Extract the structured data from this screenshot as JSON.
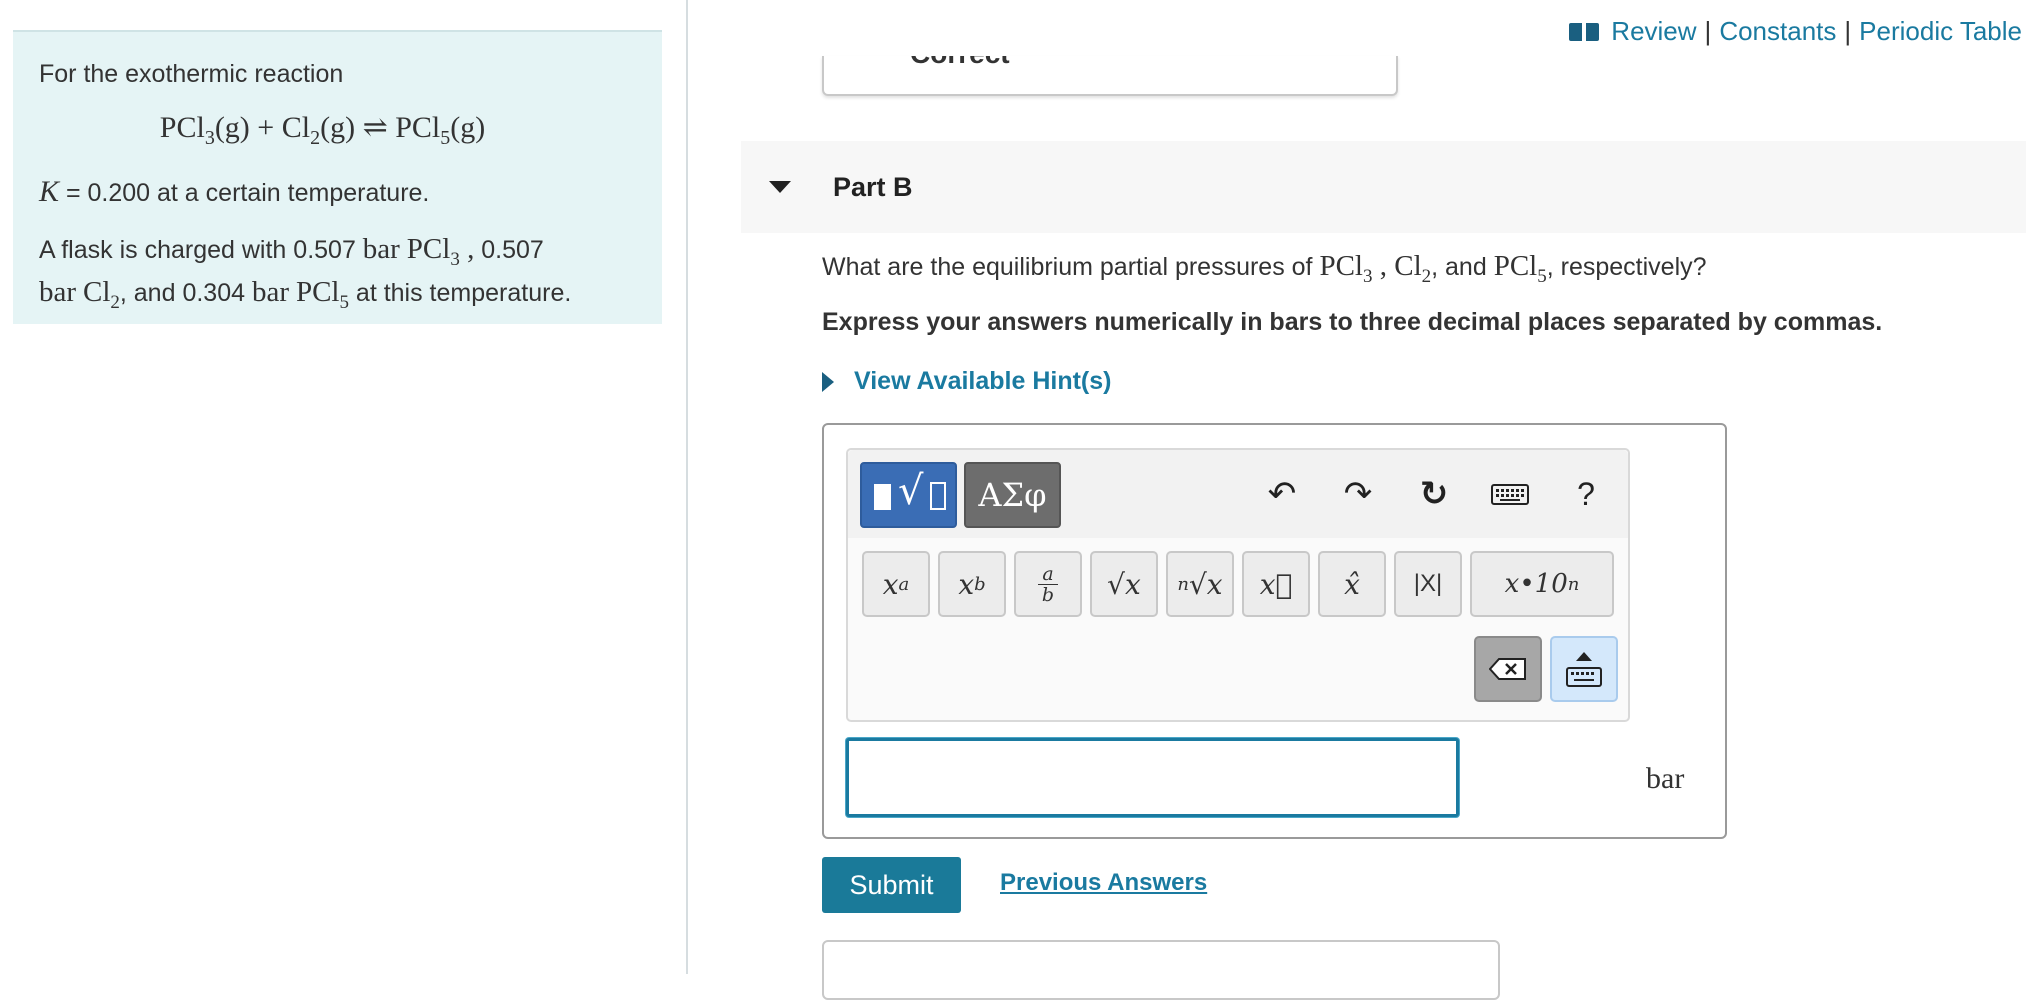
{
  "problem": {
    "intro": "For the exothermic reaction",
    "equation": {
      "reactant1": "PCl",
      "reactant1_sub": "3",
      "reactant1_state": "(g)",
      "plus": "+",
      "reactant2": "Cl",
      "reactant2_sub": "2",
      "reactant2_state": "(g)",
      "arrow": "⇌",
      "product": "PCl",
      "product_sub": "5",
      "product_state": "(g)"
    },
    "k_symbol": "K",
    "k_text": " = 0.200 at a certain temperature.",
    "flask_text_1": "A flask is charged with 0.507 ",
    "flask_bar1": "bar",
    "flask_pcl3": "PCl",
    "flask_pcl3_sub": "3",
    "flask_comma1": " ,",
    "flask_text_2": " 0.507",
    "flask_bar2": "bar",
    "flask_cl2": "Cl",
    "flask_cl2_sub": "2",
    "flask_text_3": ", and 0.304 ",
    "flask_bar3": "bar",
    "flask_pcl5": "PCl",
    "flask_pcl5_sub": "5",
    "flask_text_4": " at this temperature."
  },
  "top_links": {
    "review": "Review",
    "sep1": "|",
    "constants": "Constants",
    "sep2": "|",
    "periodic_table": "Periodic Table"
  },
  "prev_part": {
    "cut_text": "Correct"
  },
  "part": {
    "title": "Part B",
    "question_1": "What are the equilibrium partial pressures of ",
    "q_pcl3": "PCl",
    "q_pcl3_sub": "3",
    "q_comma1": " , ",
    "q_cl2": "Cl",
    "q_cl2_sub": "2",
    "question_2": ", and ",
    "q_pcl5": "PCl",
    "q_pcl5_sub": "5",
    "question_3": ", respectively?",
    "instruction": "Express your answers numerically in bars to three decimal places separated by commas.",
    "hint_label": "View Available Hint(s)"
  },
  "toolbar": {
    "greek_label": "ΑΣφ",
    "undo": "↶",
    "redo": "↷",
    "reset": "↻",
    "help": "?",
    "keys": {
      "superscript_base": "x",
      "superscript_exp": "a",
      "subscript_base": "x",
      "subscript_sub": "b",
      "frac_num": "a",
      "frac_den": "b",
      "sqrt": "√x",
      "nthroot_index": "n",
      "nthroot": "√x",
      "vector": "x⃗",
      "hat": "x̂",
      "abs": "|X|",
      "sci": "x•10",
      "sci_exp": "n"
    }
  },
  "answer": {
    "value": "",
    "unit": "bar"
  },
  "actions": {
    "submit": "Submit",
    "previous_answers": "Previous Answers"
  }
}
